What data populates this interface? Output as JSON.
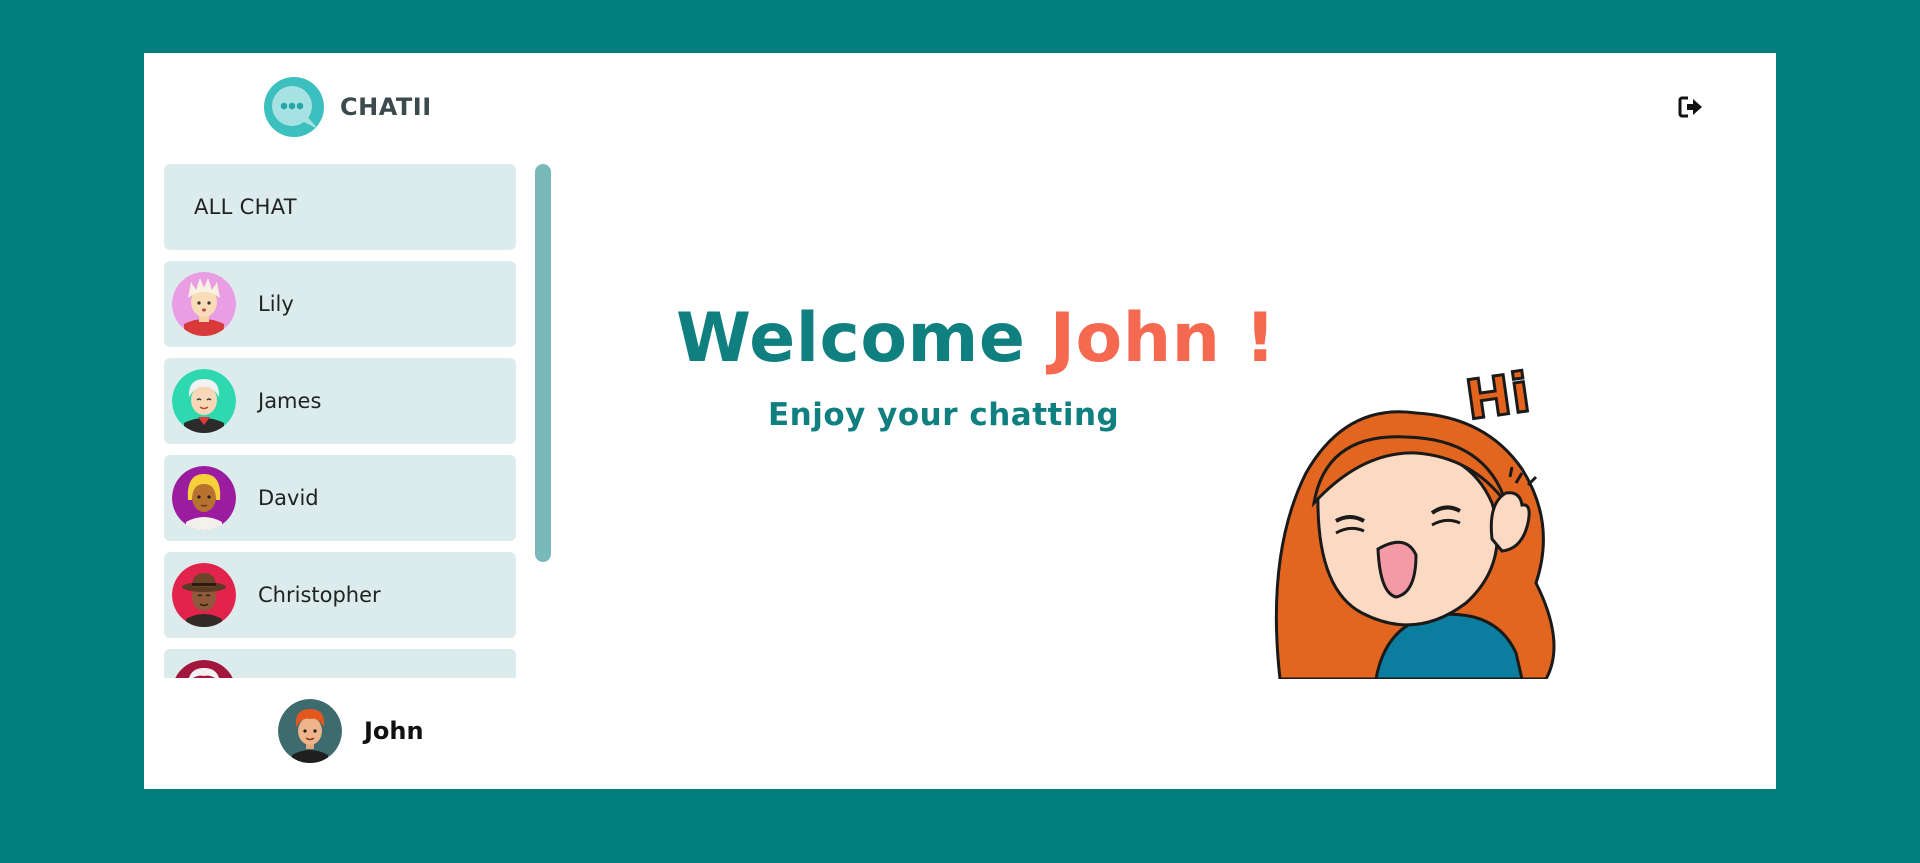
{
  "app": {
    "name": "CHATII"
  },
  "header": {
    "logout_icon": "logout-icon"
  },
  "contacts": {
    "all_chat_label": "ALL CHAT",
    "items": [
      {
        "name": "Lily"
      },
      {
        "name": "James"
      },
      {
        "name": "David"
      },
      {
        "name": "Christopher"
      }
    ]
  },
  "current_user": {
    "name": "John"
  },
  "welcome": {
    "greeting": "Welcome",
    "name": "John !",
    "subtitle": "Enjoy your chatting"
  },
  "illustration": {
    "caption": "Hi"
  },
  "colors": {
    "background": "#017f7f",
    "accent": "#0f7f80",
    "highlight": "#f4694f",
    "list_item": "#dcecec",
    "scrollbar": "#7ab9b9"
  }
}
